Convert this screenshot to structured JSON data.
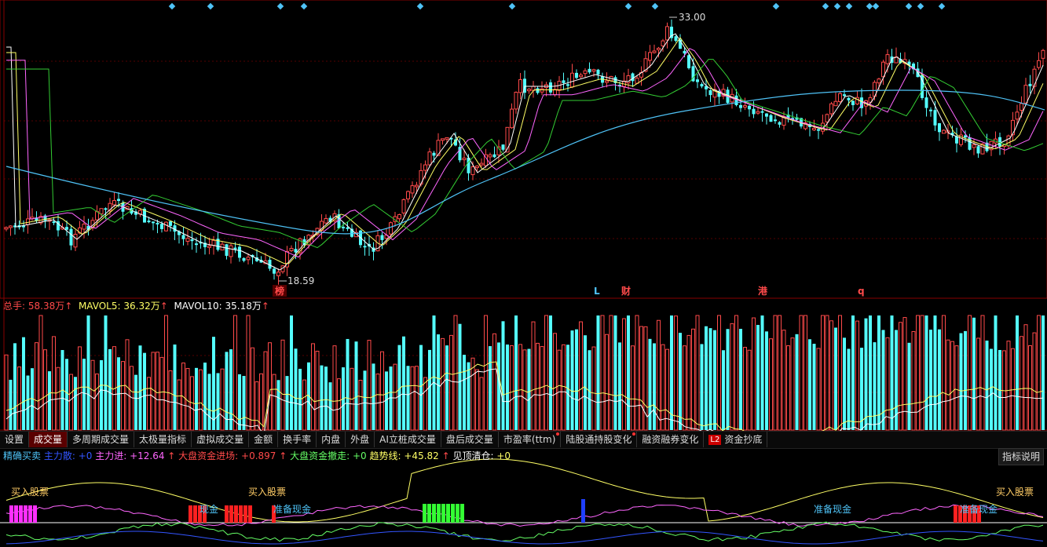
{
  "colors": {
    "up": "#ff4a4a",
    "down": "#54ffff",
    "ma5": "#ffffff",
    "ma10": "#ffff66",
    "ma20": "#ff66ff",
    "ma30": "#33cc33",
    "ma60": "#4fc3f7",
    "grid": "#550000"
  },
  "price_panel": {
    "high_label": "33.00",
    "low_label": "18.59"
  },
  "event_markers": [
    {
      "label": "榜",
      "color": "#ff4a4a",
      "bg": "#550000"
    },
    {
      "label": "L",
      "color": "#4fc3f7",
      "bg": ""
    },
    {
      "label": "财",
      "color": "#ff4a4a",
      "bg": ""
    },
    {
      "label": "港",
      "color": "#ff4a4a",
      "bg": ""
    },
    {
      "label": "q",
      "color": "#ff4a4a",
      "bg": ""
    }
  ],
  "volume_legend": [
    {
      "label": "总手:",
      "value": "58.38万",
      "color": "#ff4a4a"
    },
    {
      "label": "MAVOL5:",
      "value": "36.32万",
      "color": "#ffff66"
    },
    {
      "label": "MAVOL10:",
      "value": "35.18万",
      "color": "#ffffff"
    }
  ],
  "tabs": [
    {
      "label": "设置",
      "dot": false
    },
    {
      "label": "成交量",
      "dot": false,
      "active": true
    },
    {
      "label": "多周期成交量",
      "dot": false
    },
    {
      "label": "太极量指标",
      "dot": false
    },
    {
      "label": "虚拟成交量",
      "dot": false
    },
    {
      "label": "金额",
      "dot": false
    },
    {
      "label": "换手率",
      "dot": false
    },
    {
      "label": "内盘",
      "dot": false
    },
    {
      "label": "外盘",
      "dot": false
    },
    {
      "label": "AI立桩成交量",
      "dot": false
    },
    {
      "label": "盘后成交量",
      "dot": false
    },
    {
      "label": "市盈率(ttm)",
      "dot": true
    },
    {
      "label": "陆股通持股变化",
      "dot": true
    },
    {
      "label": "融资融券变化",
      "dot": false
    }
  ],
  "l2_tab": {
    "badge": "L2",
    "label": "资金抄底"
  },
  "help_button": "指标说明",
  "indicator_legend": [
    {
      "text": "精确买卖",
      "color": "#4fc3f7"
    },
    {
      "text": "主力散:",
      "color": "#3355ff"
    },
    {
      "text": "+0",
      "color": "#3355ff"
    },
    {
      "text": "主力进:",
      "color": "#ff66ff"
    },
    {
      "text": "+12.64",
      "color": "#ff66ff"
    },
    {
      "text": "大盘资金进场:",
      "color": "#ff4a4a"
    },
    {
      "text": "+0.897",
      "color": "#ff4a4a"
    },
    {
      "text": "大盘资金撤走:",
      "color": "#66ff66"
    },
    {
      "text": "+0",
      "color": "#66ff66"
    },
    {
      "text": "趋势线:",
      "color": "#ffff66"
    },
    {
      "text": "+45.82",
      "color": "#ffff66"
    },
    {
      "text": "见顶清仓:",
      "color": "#ffffff"
    },
    {
      "text": "+0",
      "color": "#ffff66"
    }
  ],
  "indicator_labels": [
    "买入股票",
    "现金",
    "买入股票",
    "准备现金",
    "准备现金",
    "准备现金",
    "买入股票"
  ]
}
